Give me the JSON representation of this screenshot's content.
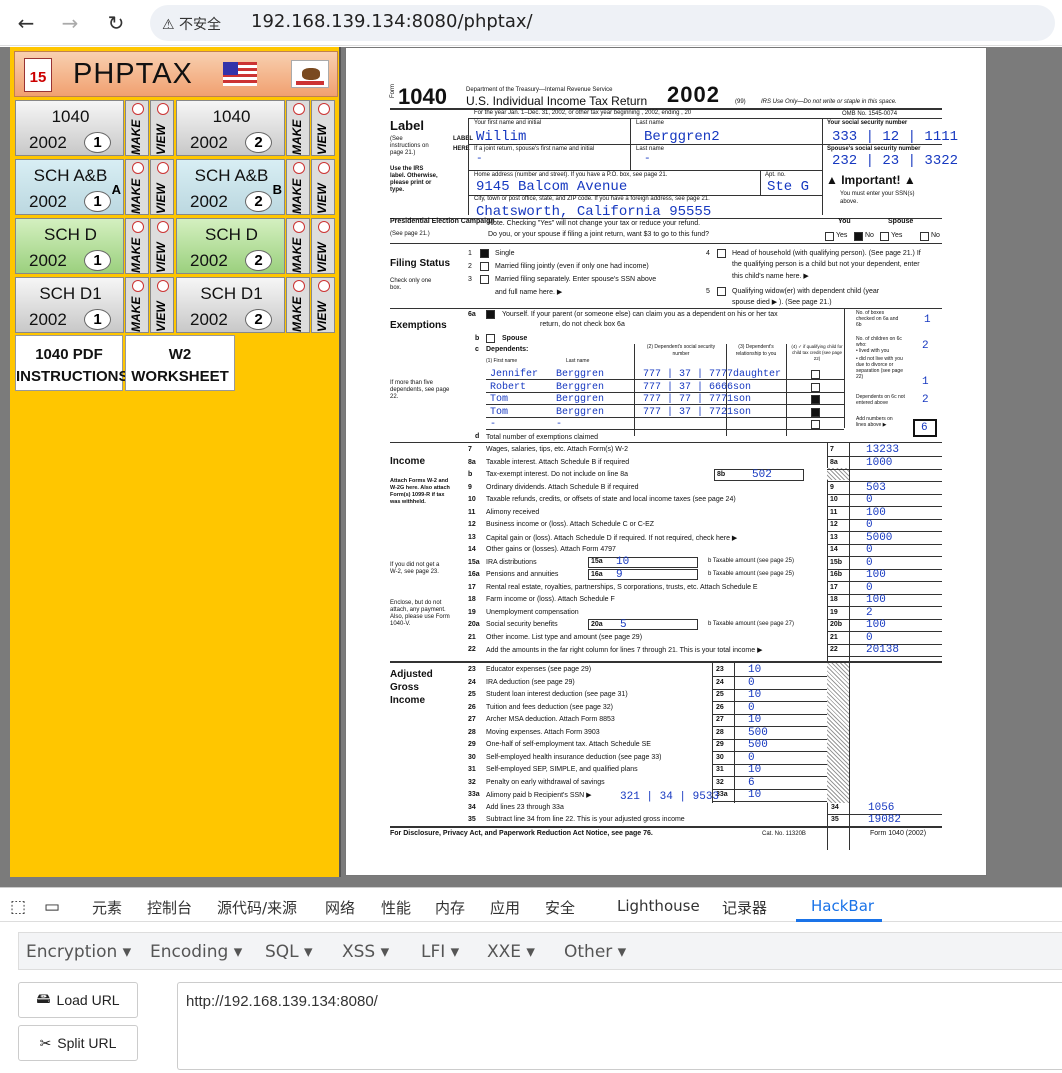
{
  "browser": {
    "back": "←",
    "forward": "→",
    "reload": "↻",
    "security": "⚠ 不安全",
    "url": "192.168.139.134:8080/phptax/"
  },
  "left": {
    "title": "PHPTAX",
    "calendar_day": "15",
    "forms": [
      {
        "name": "1040",
        "year": "2002",
        "num": "1",
        "sub": ""
      },
      {
        "name": "1040",
        "year": "2002",
        "num": "2",
        "sub": ""
      },
      {
        "name": "SCH A&B",
        "year": "2002",
        "num": "1",
        "sub": "A"
      },
      {
        "name": "SCH A&B",
        "year": "2002",
        "num": "2",
        "sub": "B"
      },
      {
        "name": "SCH D",
        "year": "2002",
        "num": "1",
        "sub": ""
      },
      {
        "name": "SCH D",
        "year": "2002",
        "num": "2",
        "sub": ""
      },
      {
        "name": "SCH D1",
        "year": "2002",
        "num": "1",
        "sub": ""
      },
      {
        "name": "SCH D1",
        "year": "2002",
        "num": "2",
        "sub": ""
      }
    ],
    "make": "MAKE",
    "view": "VIEW",
    "pdf": "1040 PDF INSTRUCTIONS",
    "w2": "W2 WORKSHEET"
  },
  "form": {
    "f_small": "Form",
    "f_num": "1040",
    "dept": "Department of the Treasury—Internal Revenue Service",
    "title": "U.S. Individual Income Tax Return",
    "year": "2002",
    "code99": "(99)",
    "irs_only": "IRS Use Only—Do not write or staple in this space.",
    "year_line": "For the year Jan. 1–Dec. 31, 2002, or other tax year beginning          , 2002, ending          , 20",
    "omb": "OMB No. 1545-0074",
    "label": "Label",
    "see_instr": "(See instructions on page 21.)",
    "use_label": "Use the IRS label. Otherwise, please print or type.",
    "label_vert": "LABEL HERE",
    "pres_head": "Presidential Election Campaign",
    "pres_see": "(See page 21.)",
    "fn_label": "Your first name and initial",
    "ln_label": "Last name",
    "ssn_label": "Your social security number",
    "first_name": "Willim",
    "last_name": "Berggren2",
    "ssn": "333 | 12 | 1111",
    "sp_label": "If a joint return, spouse's first name and initial",
    "sp_ln_label": "Last name",
    "sp_ssn_label": "Spouse's social security number",
    "sp_first": "-",
    "sp_last": "-",
    "sp_ssn": "232 | 23 | 3322",
    "addr_label": "Home address (number and street). If you have a P.O. box, see page 21.",
    "apt_label": "Apt. no.",
    "address": "9145 Balcom Avenue",
    "apt": "Ste G",
    "important": "▲ Important! ▲",
    "important_sub": "You must enter your SSN(s) above.",
    "city_label": "City, town or post office, state, and ZIP code. If you have a foreign address, see page 21.",
    "city": "Chatsworth, California 95555",
    "note1": "Note. Checking \"Yes\" will not change your tax or reduce your refund.",
    "note2": "Do you, or your spouse if filing a joint return, want $3 to go to this fund?",
    "you": "You",
    "spouse": "Spouse",
    "yes": "Yes",
    "no": "No",
    "fs_head": "Filing Status",
    "fs_check": "Check only one box.",
    "fs1": "Single",
    "fs2": "Married filing jointly (even if only one had income)",
    "fs3": "Married filing separately. Enter spouse's SSN above",
    "fs3b": "and full name here. ▶",
    "fs4": "Head of household (with qualifying person). (See page 21.) If",
    "fs4b": "the qualifying person is a child but not your dependent, enter",
    "fs4c": "this child's name here. ▶",
    "fs5": "Qualifying widow(er) with dependent child (year",
    "fs5b": "spouse died ▶          ). (See page 21.)",
    "ex_head": "Exemptions",
    "ex_6a_num": "6a",
    "ex_6a": "Yourself. If your parent (or someone else) can claim you as a dependent on his or her tax",
    "ex_6a2": "return, do not check box 6a",
    "ex_b_num": "b",
    "ex_b": "Spouse",
    "ex_c_num": "c",
    "ex_c": "Dependents:",
    "ex_fn": "(1) First name",
    "ex_ln": "Last name",
    "ex_c2": "(2) Dependent's social security number",
    "ex_c3": "(3) Dependent's relationship to you",
    "ex_c4": "(4) ✓ if qualifying child for child tax credit (see page 22)",
    "ex_more": "If more than five dependents, see page 22.",
    "boxes_checked": "No. of boxes checked on 6a and 6b",
    "n_children": "No. of children on 6c who:",
    "lived": "• lived with you",
    "not_lived": "• did not live with you due to divorce or separation (see page 22)",
    "deps_6c": "Dependents on 6c not entered above",
    "add_nums": "Add numbers on lines above ▶",
    "ex_d_num": "d",
    "ex_d": "Total number of exemptions claimed",
    "ex_vals": [
      "1",
      "2",
      "1",
      "2",
      "6"
    ],
    "dependents": [
      {
        "fn": "Jennifer",
        "ln": "Berggren",
        "ssn": "777 | 37 | 7777",
        "rel": "daughter",
        "ck": false
      },
      {
        "fn": "Robert",
        "ln": "Berggren",
        "ssn": "777 | 37 | 6666",
        "rel": "son",
        "ck": false
      },
      {
        "fn": "Tom",
        "ln": "Berggren",
        "ssn": "777 | 77 | 7771",
        "rel": "son",
        "ck": true
      },
      {
        "fn": "Tom",
        "ln": "Berggren",
        "ssn": "777 | 37 | 7721",
        "rel": "son",
        "ck": true
      },
      {
        "fn": "-",
        "ln": "-",
        "ssn": "",
        "rel": "",
        "ck": false
      }
    ],
    "inc_head": "Income",
    "inc_attach": "Attach Forms W-2 and W-2G here. Also attach Form(s) 1099-R if tax was withheld.",
    "inc_nw2": "If you did not get a W-2, see page 23.",
    "inc_enclose": "Enclose, but do not attach, any payment. Also, please use Form 1040-V.",
    "income": [
      {
        "n": "7",
        "t": "Wages, salaries, tips, etc. Attach Form(s) W-2",
        "b": "7",
        "v": "13233"
      },
      {
        "n": "8a",
        "t": "Taxable interest. Attach Schedule B if required",
        "b": "8a",
        "v": "1000"
      },
      {
        "n": "b",
        "t": "Tax-exempt interest. Do not include on line 8a",
        "b": "",
        "v": ""
      },
      {
        "n": "9",
        "t": "Ordinary dividends. Attach Schedule B if required",
        "b": "9",
        "v": "503"
      },
      {
        "n": "10",
        "t": "Taxable refunds, credits, or offsets of state and local income taxes (see page 24)",
        "b": "10",
        "v": "0"
      },
      {
        "n": "11",
        "t": "Alimony received",
        "b": "11",
        "v": "100"
      },
      {
        "n": "12",
        "t": "Business income or (loss). Attach Schedule C or C-EZ",
        "b": "12",
        "v": "0"
      },
      {
        "n": "13",
        "t": "Capital gain or (loss). Attach Schedule D if required. If not required, check here ▶",
        "b": "13",
        "v": "5000"
      },
      {
        "n": "14",
        "t": "Other gains or (losses). Attach Form 4797",
        "b": "14",
        "v": "0"
      },
      {
        "n": "15a",
        "t": "IRA distributions",
        "b": "15b",
        "v": "0"
      },
      {
        "n": "16a",
        "t": "Pensions and annuities",
        "b": "16b",
        "v": "100"
      },
      {
        "n": "17",
        "t": "Rental real estate, royalties, partnerships, S corporations, trusts, etc. Attach Schedule E",
        "b": "17",
        "v": "0"
      },
      {
        "n": "18",
        "t": "Farm income or (loss). Attach Schedule F",
        "b": "18",
        "v": "100"
      },
      {
        "n": "19",
        "t": "Unemployment compensation",
        "b": "19",
        "v": "2"
      },
      {
        "n": "20a",
        "t": "Social security benefits",
        "b": "20b",
        "v": "100"
      },
      {
        "n": "21",
        "t": "Other income. List type and amount (see page 29)",
        "b": "21",
        "v": "0"
      },
      {
        "n": "22",
        "t": "Add the amounts in the far right column for lines 7 through 21. This is your total income ▶",
        "b": "22",
        "v": "20138"
      }
    ],
    "l8b_box": "8b",
    "l8b_val": "502",
    "l15a_box": "15a",
    "l15a_val": "10",
    "l16a_box": "16a",
    "l16a_val": "9",
    "l20a_box": "20a",
    "l20a_val": "5",
    "taxable_amt": "b Taxable amount (see page 25)",
    "taxable_amt27": "b Taxable amount (see page 27)",
    "agi_head": "Adjusted Gross Income",
    "agi": [
      {
        "n": "23",
        "t": "Educator expenses (see page 29)",
        "v": "10"
      },
      {
        "n": "24",
        "t": "IRA deduction (see page 29)",
        "v": "0"
      },
      {
        "n": "25",
        "t": "Student loan interest deduction (see page 31)",
        "v": "10"
      },
      {
        "n": "26",
        "t": "Tuition and fees deduction (see page 32)",
        "v": "0"
      },
      {
        "n": "27",
        "t": "Archer MSA deduction. Attach Form 8853",
        "v": "10"
      },
      {
        "n": "28",
        "t": "Moving expenses. Attach Form 3903",
        "v": "500"
      },
      {
        "n": "29",
        "t": "One-half of self-employment tax. Attach Schedule SE",
        "v": "500"
      },
      {
        "n": "30",
        "t": "Self-employed health insurance deduction (see page 33)",
        "v": "0"
      },
      {
        "n": "31",
        "t": "Self-employed SEP, SIMPLE, and qualified plans",
        "v": "10"
      },
      {
        "n": "32",
        "t": "Penalty on early withdrawal of savings",
        "v": "6"
      },
      {
        "n": "33a",
        "t": "Alimony paid   b Recipient's SSN ▶",
        "v": "10"
      }
    ],
    "recip_ssn": "321 | 34 | 9533",
    "l34_n": "34",
    "l34_t": "Add lines 23 through 33a",
    "l34_v": "1056",
    "l35_n": "35",
    "l35_t": "Subtract line 34 from line 22. This is your adjusted gross income",
    "l35_v": "19082",
    "footer": "For Disclosure, Privacy Act, and Paperwork Reduction Act Notice, see page 76.",
    "cat": "Cat. No. 11320B",
    "footer_form": "Form 1040 (2002)"
  },
  "devtools": {
    "tabs": [
      "元素",
      "控制台",
      "源代码/来源",
      "网络",
      "性能",
      "内存",
      "应用",
      "安全",
      "Lighthouse",
      "记录器",
      "HackBar"
    ],
    "menu": [
      "Encryption ▾",
      "Encoding ▾",
      "SQL ▾",
      "XSS ▾",
      "LFI ▾",
      "XXE ▾",
      "Other ▾"
    ],
    "load_url": "Load URL",
    "split_url": "Split URL",
    "url_value": "http://192.168.139.134:8080/"
  }
}
